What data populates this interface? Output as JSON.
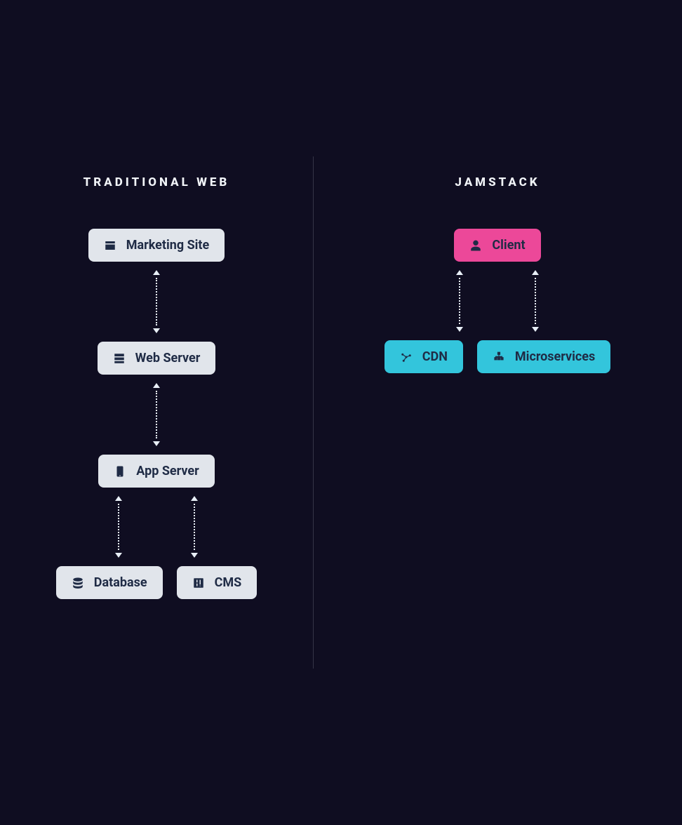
{
  "left": {
    "title": "Traditional web",
    "nodes": {
      "marketing": "Marketing Site",
      "web_server": "Web Server",
      "app_server": "App Server",
      "database": "Database",
      "cms": "CMS"
    }
  },
  "right": {
    "title": "Jamstack",
    "nodes": {
      "client": "Client",
      "cdn": "CDN",
      "microservices": "Microservices"
    }
  }
}
